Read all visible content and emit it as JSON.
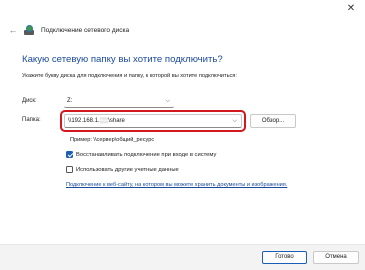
{
  "window": {
    "title": "Подключение сетевого диска",
    "close_glyph": "✕",
    "back_glyph": "←"
  },
  "main": {
    "heading": "Какую сетевую папку вы хотите подключить?",
    "subheading": "Укажите букву диска для подключения и папку, к которой вы хотите подключиться:",
    "drive_label": "Диск:",
    "drive_value": "Z:",
    "folder_label": "Папка:",
    "folder_value_prefix": "\\\\192.168.1.",
    "folder_value_masked": "▒▒",
    "folder_value_suffix": "\\share",
    "browse_label": "Обзор...",
    "example": "Пример: \\\\сервер\\общий_ресурс",
    "reconnect_label": "Восстанавливать подключение при входе в систему",
    "reconnect_checked": true,
    "other_creds_label": "Использовать другие учетные данные",
    "other_creds_checked": false,
    "link_text": "Подключение к веб-сайту, на котором вы можете хранить документы и изображения."
  },
  "footer": {
    "finish_label": "Готово",
    "cancel_label": "Отмена"
  },
  "colors": {
    "accent": "#1a5fb4",
    "heading": "#1a4a9c",
    "highlight": "#d0181e"
  }
}
